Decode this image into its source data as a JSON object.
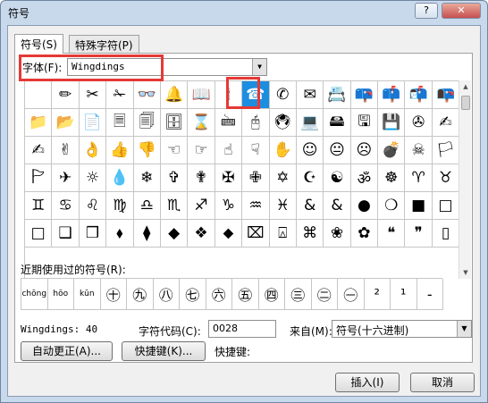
{
  "window": {
    "title": "符号"
  },
  "titlebar": {
    "help": "?",
    "close": "✕"
  },
  "tabs": [
    "符号(S)",
    "特殊字符(P)"
  ],
  "font": {
    "label": "字体(F):",
    "value": "Wingdings",
    "arrow": "▼"
  },
  "symbols": [
    "",
    "✏",
    "✂",
    "✁",
    "👓",
    "🔔",
    "📖",
    "🕯",
    "☎",
    "✆",
    "✉",
    "📇",
    "📪",
    "📫",
    "📬",
    "📭",
    "📁",
    "📂",
    "📄",
    "🗏",
    "🗐",
    "🗄",
    "⌛",
    "🖮",
    "🖰",
    "🖲",
    "💻",
    "🖴",
    "🖫",
    "💾",
    "✇",
    "✍",
    "✍",
    "✌",
    "👌",
    "👍",
    "👎",
    "☜",
    "☞",
    "☝",
    "☟",
    "✋",
    "☺",
    "😐",
    "☹",
    "💣",
    "☠",
    "🏳",
    "🏱",
    "✈",
    "☼",
    "💧",
    "❄",
    "✞",
    "✟",
    "✠",
    "✙",
    "✡",
    "☪",
    "☯",
    "ॐ",
    "☸",
    "♈",
    "♉",
    "♊",
    "♋",
    "♌",
    "♍",
    "♎",
    "♏",
    "♐",
    "♑",
    "♒",
    "♓",
    "&",
    "&",
    "●",
    "❍",
    "■",
    "□",
    "□",
    "❑",
    "❒",
    "⬧",
    "⧫",
    "◆",
    "❖",
    "⬥",
    "⌧",
    "⍓",
    "⌘",
    "❀",
    "✿",
    "❝",
    "❞",
    "▯"
  ],
  "scrollbar": {
    "up": "▲",
    "down": "▼"
  },
  "recent": {
    "label": "近期使用过的符号(R):",
    "items": [
      "chōng",
      "hōo",
      "kūn",
      "㊉",
      "㊈",
      "㊇",
      "㊆",
      "㊅",
      "㊄",
      "㊃",
      "㊂",
      "㊁",
      "㊀",
      "²",
      "¹",
      "-"
    ]
  },
  "info": {
    "name": "Wingdings: 40",
    "code_label": "字符代码(C):",
    "code_value": "0028",
    "from_label": "来自(M):",
    "from_value": "符号(十六进制)",
    "arrow": "▼"
  },
  "buttons": {
    "autocorrect": "自动更正(A)...",
    "shortcut": "快捷键(K)...",
    "shortcut_label": "快捷键:",
    "insert": "插入(I)",
    "cancel": "取消"
  }
}
